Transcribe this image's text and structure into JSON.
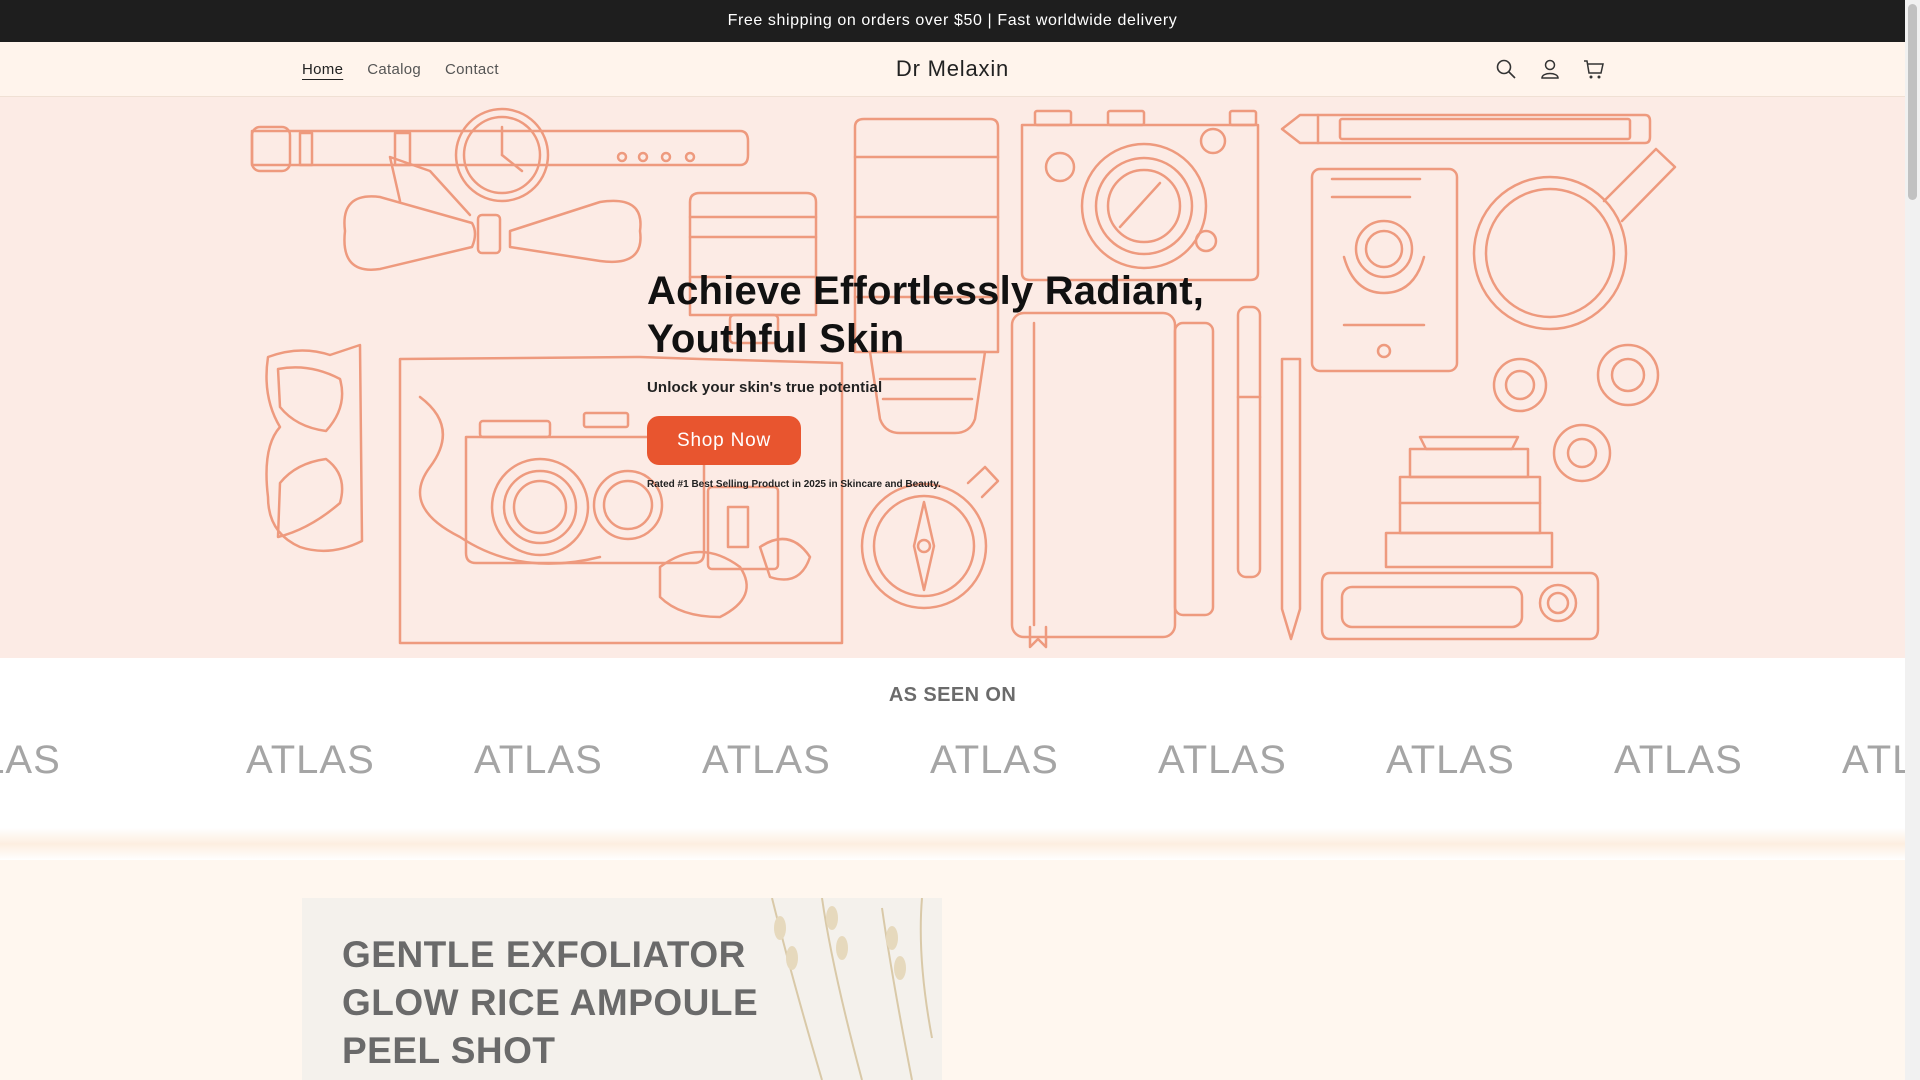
{
  "announcement": {
    "text": "Free shipping on orders over $50 | Fast worldwide delivery"
  },
  "header": {
    "nav": [
      {
        "label": "Home"
      },
      {
        "label": "Catalog"
      },
      {
        "label": "Contact"
      }
    ],
    "logo": "Dr Melaxin",
    "icons": [
      "search-icon",
      "account-icon",
      "cart-icon"
    ]
  },
  "hero": {
    "title_line1": "Achieve Effortlessly Radiant,",
    "title_line2": "Youthful Skin",
    "subtitle": "Unlock your skin's true potential",
    "button_label": "Shop Now",
    "note": "Rated #1 Best Selling Product in 2025 in Skincare and Beauty."
  },
  "seen_on": {
    "title": "AS SEEN ON",
    "logos": [
      "ATLAS",
      "ATLAS",
      "ATLAS",
      "ATLAS",
      "ATLAS",
      "ATLAS",
      "ATLAS",
      "ATLAS",
      "ATLAS"
    ]
  },
  "product": {
    "line1": "GENTLE EXFOLIATOR",
    "line2": "GLOW RICE AMPOULE",
    "line3": "PEEL SHOT"
  },
  "colors": {
    "accent": "#e8552f",
    "illustration": "#ee9a7e",
    "hero_bg": "#fcebe5",
    "header_bg": "#fff4ec",
    "announcement_bg": "#1e1e1e"
  }
}
